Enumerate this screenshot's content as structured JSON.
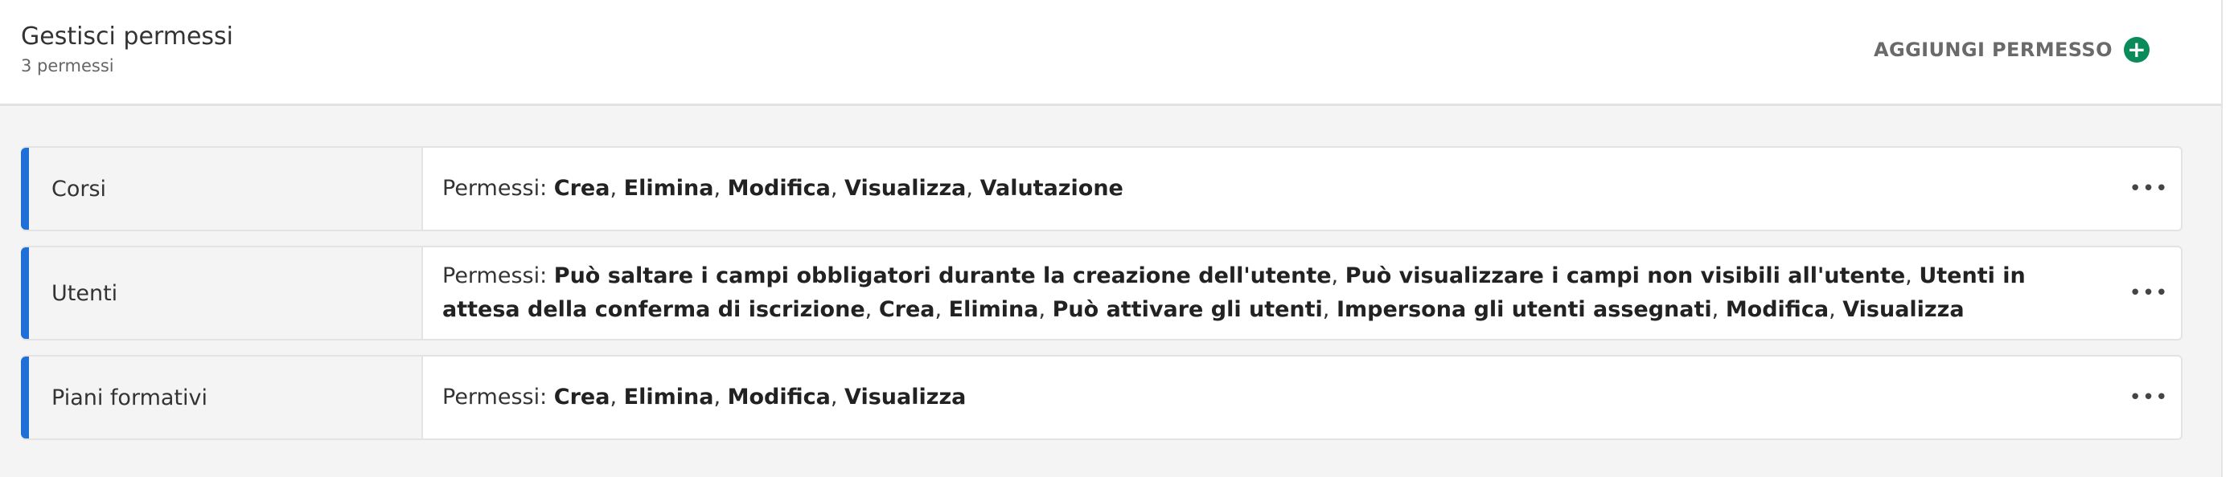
{
  "header": {
    "title": "Gestisci permessi",
    "subtitle": "3 permessi",
    "add_button_label": "AGGIUNGI PERMESSO",
    "add_icon": "plus-circle-icon"
  },
  "rows": [
    {
      "name": "Corsi",
      "prefix": "Permessi:",
      "permissions": [
        "Crea",
        "Elimina",
        "Modifica",
        "Visualizza",
        "Valutazione"
      ],
      "menu_icon": "more-horizontal-icon"
    },
    {
      "name": "Utenti",
      "prefix": "Permessi:",
      "permissions": [
        "Può saltare i campi obbligatori durante la creazione dell'utente",
        "Può visualizzare i campi non visibili all'utente",
        "Utenti in attesa della conferma di iscrizione",
        "Crea",
        "Elimina",
        "Può attivare gli utenti",
        "Impersona gli utenti assegnati",
        "Modifica",
        "Visualizza"
      ],
      "menu_icon": "more-horizontal-icon"
    },
    {
      "name": "Piani formativi",
      "prefix": "Permessi:",
      "permissions": [
        "Crea",
        "Elimina",
        "Modifica",
        "Visualizza"
      ],
      "menu_icon": "more-horizontal-icon"
    }
  ],
  "colors": {
    "accent": "#1f6fd6",
    "add_icon_bg": "#0b8a5a"
  }
}
